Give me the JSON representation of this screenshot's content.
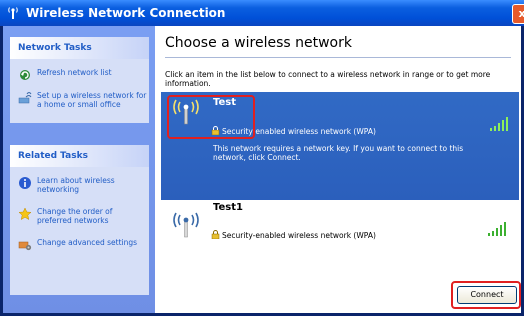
{
  "window": {
    "title": "Wireless Network Connection",
    "close_glyph": "x"
  },
  "left": {
    "network_tasks": {
      "title": "Network Tasks",
      "items": [
        {
          "label": "Refresh network list",
          "icon": "refresh-icon"
        },
        {
          "label": "Set up a wireless network for a home or small office",
          "icon": "setup-network-icon"
        }
      ]
    },
    "related_tasks": {
      "title": "Related Tasks",
      "items": [
        {
          "label": "Learn about wireless networking",
          "icon": "info-icon"
        },
        {
          "label": "Change the order of preferred networks",
          "icon": "star-icon"
        },
        {
          "label": "Change advanced settings",
          "icon": "settings-icon"
        }
      ]
    }
  },
  "main": {
    "heading": "Choose a wireless network",
    "intro": "Click an item in the list below to connect to a wireless network in range or to get more information.",
    "networks": [
      {
        "ssid": "Test",
        "security": "Security-enabled wireless network (WPA)",
        "description": "This network requires a network key. If you want to connect to this network, click Connect.",
        "signal_bars": 5,
        "selected": true
      },
      {
        "ssid": "Test1",
        "security": "Security-enabled wireless network (WPA)",
        "signal_bars": 5,
        "selected": false
      }
    ],
    "connect_label": "Connect"
  },
  "colors": {
    "selection": "#316ac5",
    "highlight": "#e02020",
    "link": "#215dc6"
  }
}
